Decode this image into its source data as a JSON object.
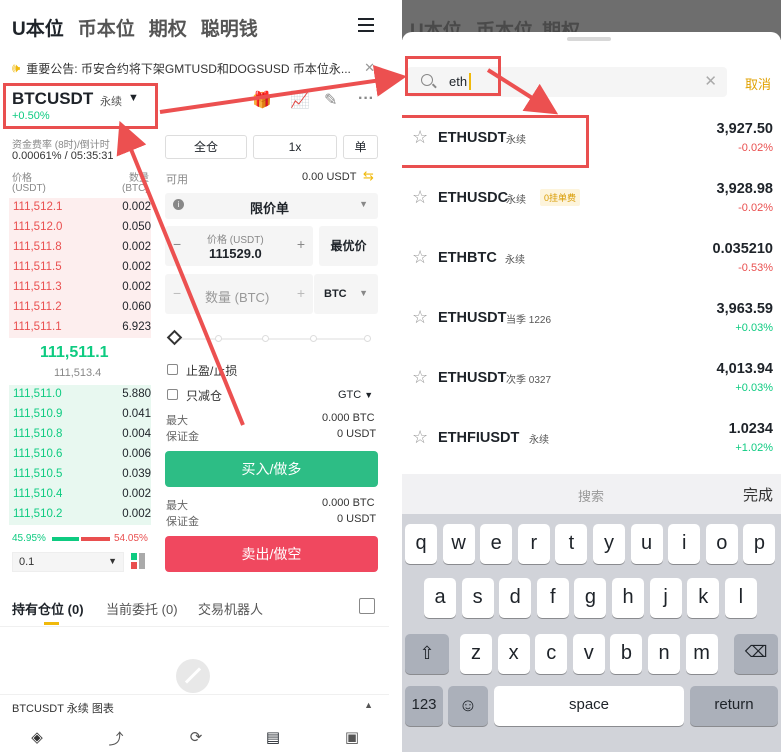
{
  "left": {
    "top_tabs": [
      "U本位",
      "币本位",
      "期权",
      "聪明钱"
    ],
    "notice": "重要公告: 币安合约将下架GMTUSD和DOGSUSD 币本位永...",
    "pair": {
      "name": "BTCUSDT",
      "type": "永续",
      "change": "+0.50%"
    },
    "funding_label": "资金费率 (8时)/倒计时",
    "funding_value": "0.00061% / 05:35:31",
    "ob_price_hdr": "价格",
    "ob_price_unit": "(USDT)",
    "ob_qty_hdr": "数量",
    "ob_qty_unit": "(BTC)",
    "asks": [
      {
        "p": "111,512.1",
        "q": "0.002"
      },
      {
        "p": "111,512.0",
        "q": "0.050"
      },
      {
        "p": "111,511.8",
        "q": "0.002"
      },
      {
        "p": "111,511.5",
        "q": "0.002"
      },
      {
        "p": "111,511.3",
        "q": "0.002"
      },
      {
        "p": "111,511.2",
        "q": "0.060"
      },
      {
        "p": "111,511.1",
        "q": "6.923"
      }
    ],
    "mid_price": "111,511.1",
    "mark_price": "111,513.4",
    "bids": [
      {
        "p": "111,511.0",
        "q": "5.880"
      },
      {
        "p": "111,510.9",
        "q": "0.041"
      },
      {
        "p": "111,510.8",
        "q": "0.004"
      },
      {
        "p": "111,510.6",
        "q": "0.006"
      },
      {
        "p": "111,510.5",
        "q": "0.039"
      },
      {
        "p": "111,510.4",
        "q": "0.002"
      },
      {
        "p": "111,510.2",
        "q": "0.002"
      }
    ],
    "buy_ratio": "45.95%",
    "sell_ratio": "54.05%",
    "buy_ratio_value": 45.95,
    "depth": "0.1",
    "margin_mode": "全仓",
    "leverage": "1x",
    "side_mode": "单",
    "available_label": "可用",
    "available_value": "0.00 USDT",
    "order_type": "限价单",
    "price_label": "价格 (USDT)",
    "price_value": "111529.0",
    "best_price": "最优价",
    "qty_placeholder": "数量 (BTC)",
    "qty_unit": "BTC",
    "tpsl": "止盈/止损",
    "reduce_only": "只减仓",
    "tif": "GTC",
    "max_label": "最大",
    "margin_label": "保证金",
    "buy_max": "0.000 BTC",
    "buy_margin": "0 USDT",
    "buy_button": "买入/做多",
    "sell_max": "0.000 BTC",
    "sell_margin": "0 USDT",
    "sell_button": "卖出/做空",
    "bottom_tabs": {
      "positions": "持有仓位",
      "positions_count": "(0)",
      "orders": "当前委托",
      "orders_count": "(0)",
      "bots": "交易机器人"
    },
    "chart_bar": "BTCUSDT 永续  图表"
  },
  "right": {
    "dim_tabs": [
      "U本位",
      "币本位",
      "期权"
    ],
    "search_value": "eth",
    "cancel": "取消",
    "results": [
      {
        "name": "ETHUSDT",
        "tag": "永续",
        "badge": "",
        "price": "3,927.50",
        "change": "-0.02%",
        "dir": "neg"
      },
      {
        "name": "ETHUSDC",
        "tag": "永续",
        "badge": "0挂单费",
        "price": "3,928.98",
        "change": "-0.02%",
        "dir": "neg"
      },
      {
        "name": "ETHBTC",
        "tag": "永续",
        "badge": "",
        "price": "0.035210",
        "change": "-0.53%",
        "dir": "neg"
      },
      {
        "name": "ETHUSDT",
        "tag": "当季 1226",
        "badge": "",
        "price": "3,963.59",
        "change": "+0.03%",
        "dir": "pos"
      },
      {
        "name": "ETHUSDT",
        "tag": "次季 0327",
        "badge": "",
        "price": "4,013.94",
        "change": "+0.03%",
        "dir": "pos"
      },
      {
        "name": "ETHFIUSDT",
        "tag": "永续",
        "badge": "",
        "price": "1.0234",
        "change": "+1.02%",
        "dir": "pos"
      }
    ],
    "kb_search": "搜索",
    "kb_done": "完成",
    "kb_row1": [
      "q",
      "w",
      "e",
      "r",
      "t",
      "y",
      "u",
      "i",
      "o",
      "p"
    ],
    "kb_row2": [
      "a",
      "s",
      "d",
      "f",
      "g",
      "h",
      "j",
      "k",
      "l"
    ],
    "kb_row3": [
      "z",
      "x",
      "c",
      "v",
      "b",
      "n",
      "m"
    ],
    "kb_123": "123",
    "kb_space": "space",
    "kb_return": "return"
  },
  "colors": {
    "red": "#e94f4f",
    "green": "#0ecb81",
    "accent": "#f0b90b"
  }
}
